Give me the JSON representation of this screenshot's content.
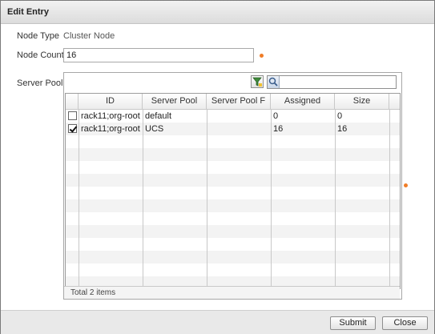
{
  "dialog": {
    "title": "Edit Entry"
  },
  "form": {
    "node_type_label": "Node Type",
    "node_type_value": "Cluster Node",
    "node_count_label": "Node Count",
    "node_count_value": "16",
    "server_pool_label": "Server Pool"
  },
  "search": {
    "placeholder": ""
  },
  "table": {
    "columns": [
      "ID",
      "Server Pool",
      "Server Pool F",
      "Assigned",
      "Size"
    ],
    "rows": [
      {
        "checked": false,
        "id": "rack11;org-root",
        "server_pool": "default",
        "server_pool_f": "",
        "assigned": "0",
        "size": "0"
      },
      {
        "checked": true,
        "id": "rack11;org-root",
        "server_pool": "UCS",
        "server_pool_f": "",
        "assigned": "16",
        "size": "16"
      }
    ],
    "total": "Total 2 items"
  },
  "buttons": {
    "submit": "Submit",
    "close": "Close"
  },
  "colors": {
    "required": "#f07d27",
    "header_bg": "#e6e6e6",
    "button_bar": "#e9e9e9"
  },
  "icons": {
    "filter": "filter-icon",
    "search": "search-icon",
    "required": "required-dot-icon"
  }
}
